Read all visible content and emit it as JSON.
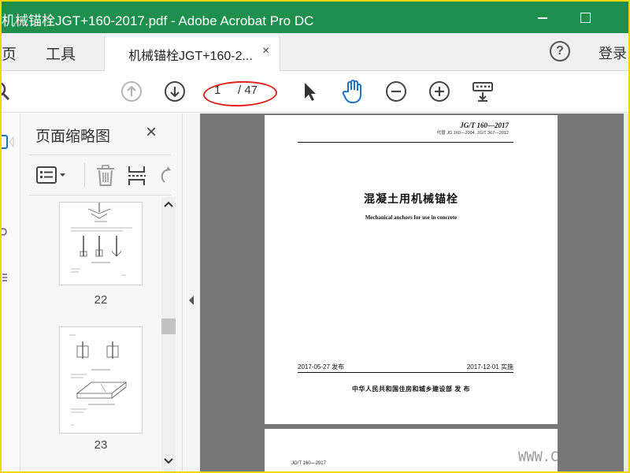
{
  "window": {
    "title": "机械锚栓JGT+160-2017.pdf - Adobe Acrobat Pro DC"
  },
  "tabbar": {
    "home_label": "页",
    "tools_label": "工具",
    "doc_tab_label": "机械锚栓JGT+160-2...",
    "doc_tab_close": "×",
    "help_label": "?",
    "signin_label": "登录"
  },
  "toolbar": {
    "current_page": "1",
    "total_pages": "/ 47",
    "accent_color": "#1a73c7",
    "annotation_color": "#e0241b"
  },
  "thumbnails": {
    "title": "页面缩略图",
    "close": "×",
    "items": [
      {
        "label": "22"
      },
      {
        "label": "23"
      }
    ]
  },
  "document": {
    "standard_code": "JG/T 160—2017",
    "replaces": "代替 JG 160—2004, JG/T 367—2012",
    "title_cn": "混凝土用机械锚栓",
    "title_en": "Mechanical anchors for use in concrete",
    "publish_date": "2017-05-27 发布",
    "implement_date": "2017-12-01 实施",
    "issuer": "中华人民共和国住房和城乡建设部    发 布",
    "next_page_code": "JG/T 160—2017",
    "watermark": "WWW.C"
  },
  "colors": {
    "titlebar_bg": "#1e8f4d",
    "frame_border": "#f2d700",
    "viewport_bg": "#777777"
  }
}
